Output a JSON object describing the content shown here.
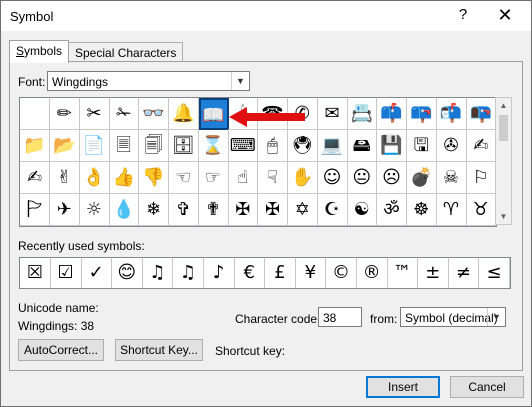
{
  "window": {
    "title": "Symbol",
    "help": "?",
    "close": "✕"
  },
  "tabs": [
    {
      "label": "Symbols"
    },
    {
      "label": "Special Characters"
    }
  ],
  "font": {
    "label": "Font:",
    "value": "Wingdings"
  },
  "grid": {
    "rows": [
      [
        " ",
        "✏",
        "✂",
        "✁",
        "👓",
        "🔔",
        "📖",
        "🕯",
        "☎",
        "✆",
        "✉",
        "📇",
        "📫",
        "📪",
        "📬",
        "📭"
      ],
      [
        "📁",
        "📂",
        "📄",
        "🗏",
        "🗐",
        "🗄",
        "⌛",
        "⌨",
        "🖱",
        "🖲",
        "💻",
        "🖴",
        "💾",
        "🖫",
        "✇",
        "✍"
      ],
      [
        "✍",
        "✌",
        "👌",
        "👍",
        "👎",
        "☜",
        "☞",
        "☝",
        "☟",
        "✋",
        "☺",
        "😐",
        "☹",
        "💣",
        "☠",
        "⚐"
      ],
      [
        "🏱",
        "✈",
        "☼",
        "💧",
        "❄",
        "✞",
        "✟",
        "✠",
        "✠",
        "✡",
        "☪",
        "☯",
        "ॐ",
        "☸",
        "♈",
        "♉"
      ]
    ],
    "selected_index": 6
  },
  "recent": {
    "label": "Recently used symbols:",
    "symbols": [
      "☒",
      "☑",
      "✓",
      "😊",
      "♫",
      "♫",
      "♪",
      "€",
      "£",
      "¥",
      "©",
      "®",
      "™",
      "±",
      "≠",
      "≤"
    ]
  },
  "unicode": {
    "label": "Unicode name:",
    "value": "Wingdings: 38"
  },
  "charcode": {
    "label": "Character code:",
    "value": "38"
  },
  "from": {
    "label": "from:",
    "value": "Symbol (decimal)"
  },
  "buttons": {
    "autocorrect": "AutoCorrect...",
    "shortcut_key": "Shortcut Key...",
    "shortcut_label": "Shortcut key:",
    "insert": "Insert",
    "cancel": "Cancel"
  },
  "colors": {
    "selection": "#1e7fd6",
    "annotation_arrow": "#e01010"
  }
}
